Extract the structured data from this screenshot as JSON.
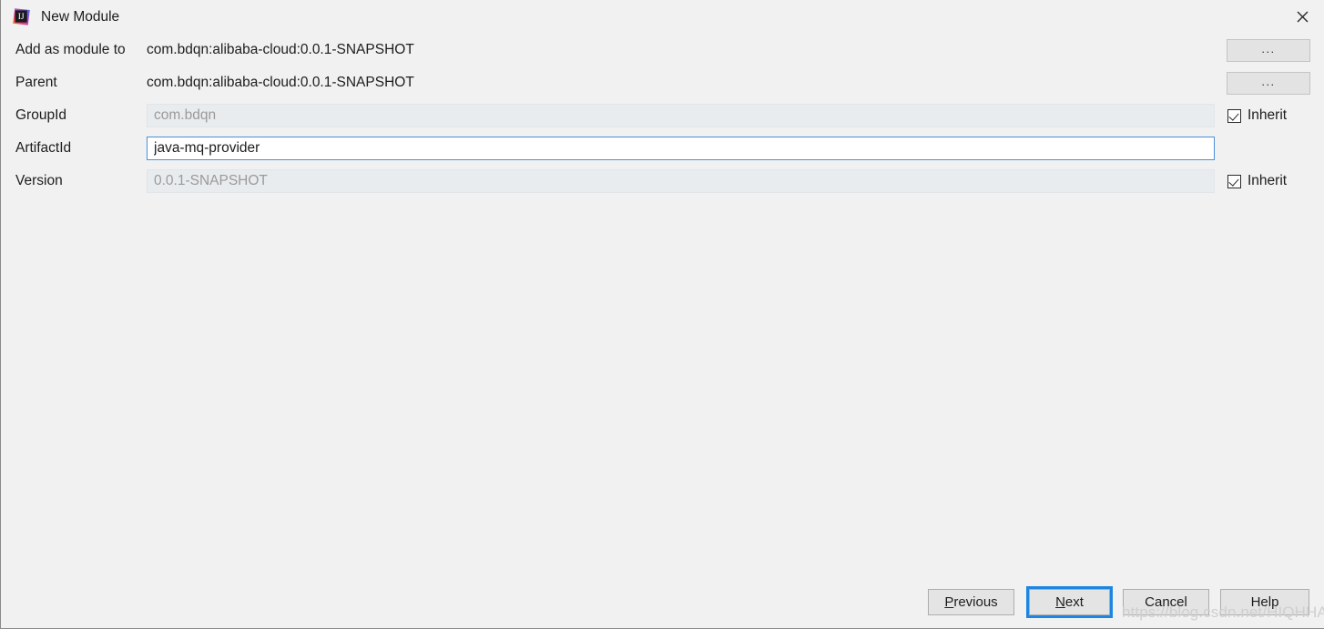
{
  "window": {
    "title": "New Module",
    "app_icon": "intellij-idea-icon",
    "close_icon": "close-icon",
    "background": "#f1f1f1"
  },
  "form": {
    "rows": [
      {
        "label": "Add as module to",
        "kind": "static",
        "value": "com.bdqn:alibaba-cloud:0.0.1-SNAPSHOT",
        "trailing": "browse",
        "trailing_label": "..."
      },
      {
        "label": "Parent",
        "kind": "static",
        "value": "com.bdqn:alibaba-cloud:0.0.1-SNAPSHOT",
        "trailing": "browse",
        "trailing_label": "..."
      },
      {
        "label": "GroupId",
        "kind": "input",
        "value": "com.bdqn",
        "state": "disabled",
        "trailing": "checkbox",
        "trailing_label": "Inherit",
        "checked": true
      },
      {
        "label": "ArtifactId",
        "kind": "input",
        "value": "java-mq-provider",
        "state": "active",
        "trailing": "none"
      },
      {
        "label": "Version",
        "kind": "input",
        "value": "0.0.1-SNAPSHOT",
        "state": "disabled",
        "trailing": "checkbox",
        "trailing_label": "Inherit",
        "checked": true
      }
    ]
  },
  "footer": {
    "buttons": [
      {
        "id": "previous",
        "label": "Previous",
        "mnemonic": "P",
        "rest": "revious",
        "focused": false
      },
      {
        "id": "next",
        "label": "Next",
        "mnemonic": "N",
        "rest": "ext",
        "focused": true
      },
      {
        "id": "cancel",
        "label": "Cancel",
        "mnemonic": "",
        "rest": "Cancel",
        "focused": false
      },
      {
        "id": "help",
        "label": "Help",
        "mnemonic": "",
        "rest": "Help",
        "focused": false
      }
    ]
  },
  "watermark": {
    "text": "https://blog.csdn.net/HIQHHA"
  },
  "colors": {
    "focus_blue": "#1d86e0",
    "field_border_active": "#4a90d9",
    "disabled_field_bg": "#e9ecee",
    "button_bg": "#e4e4e4"
  }
}
